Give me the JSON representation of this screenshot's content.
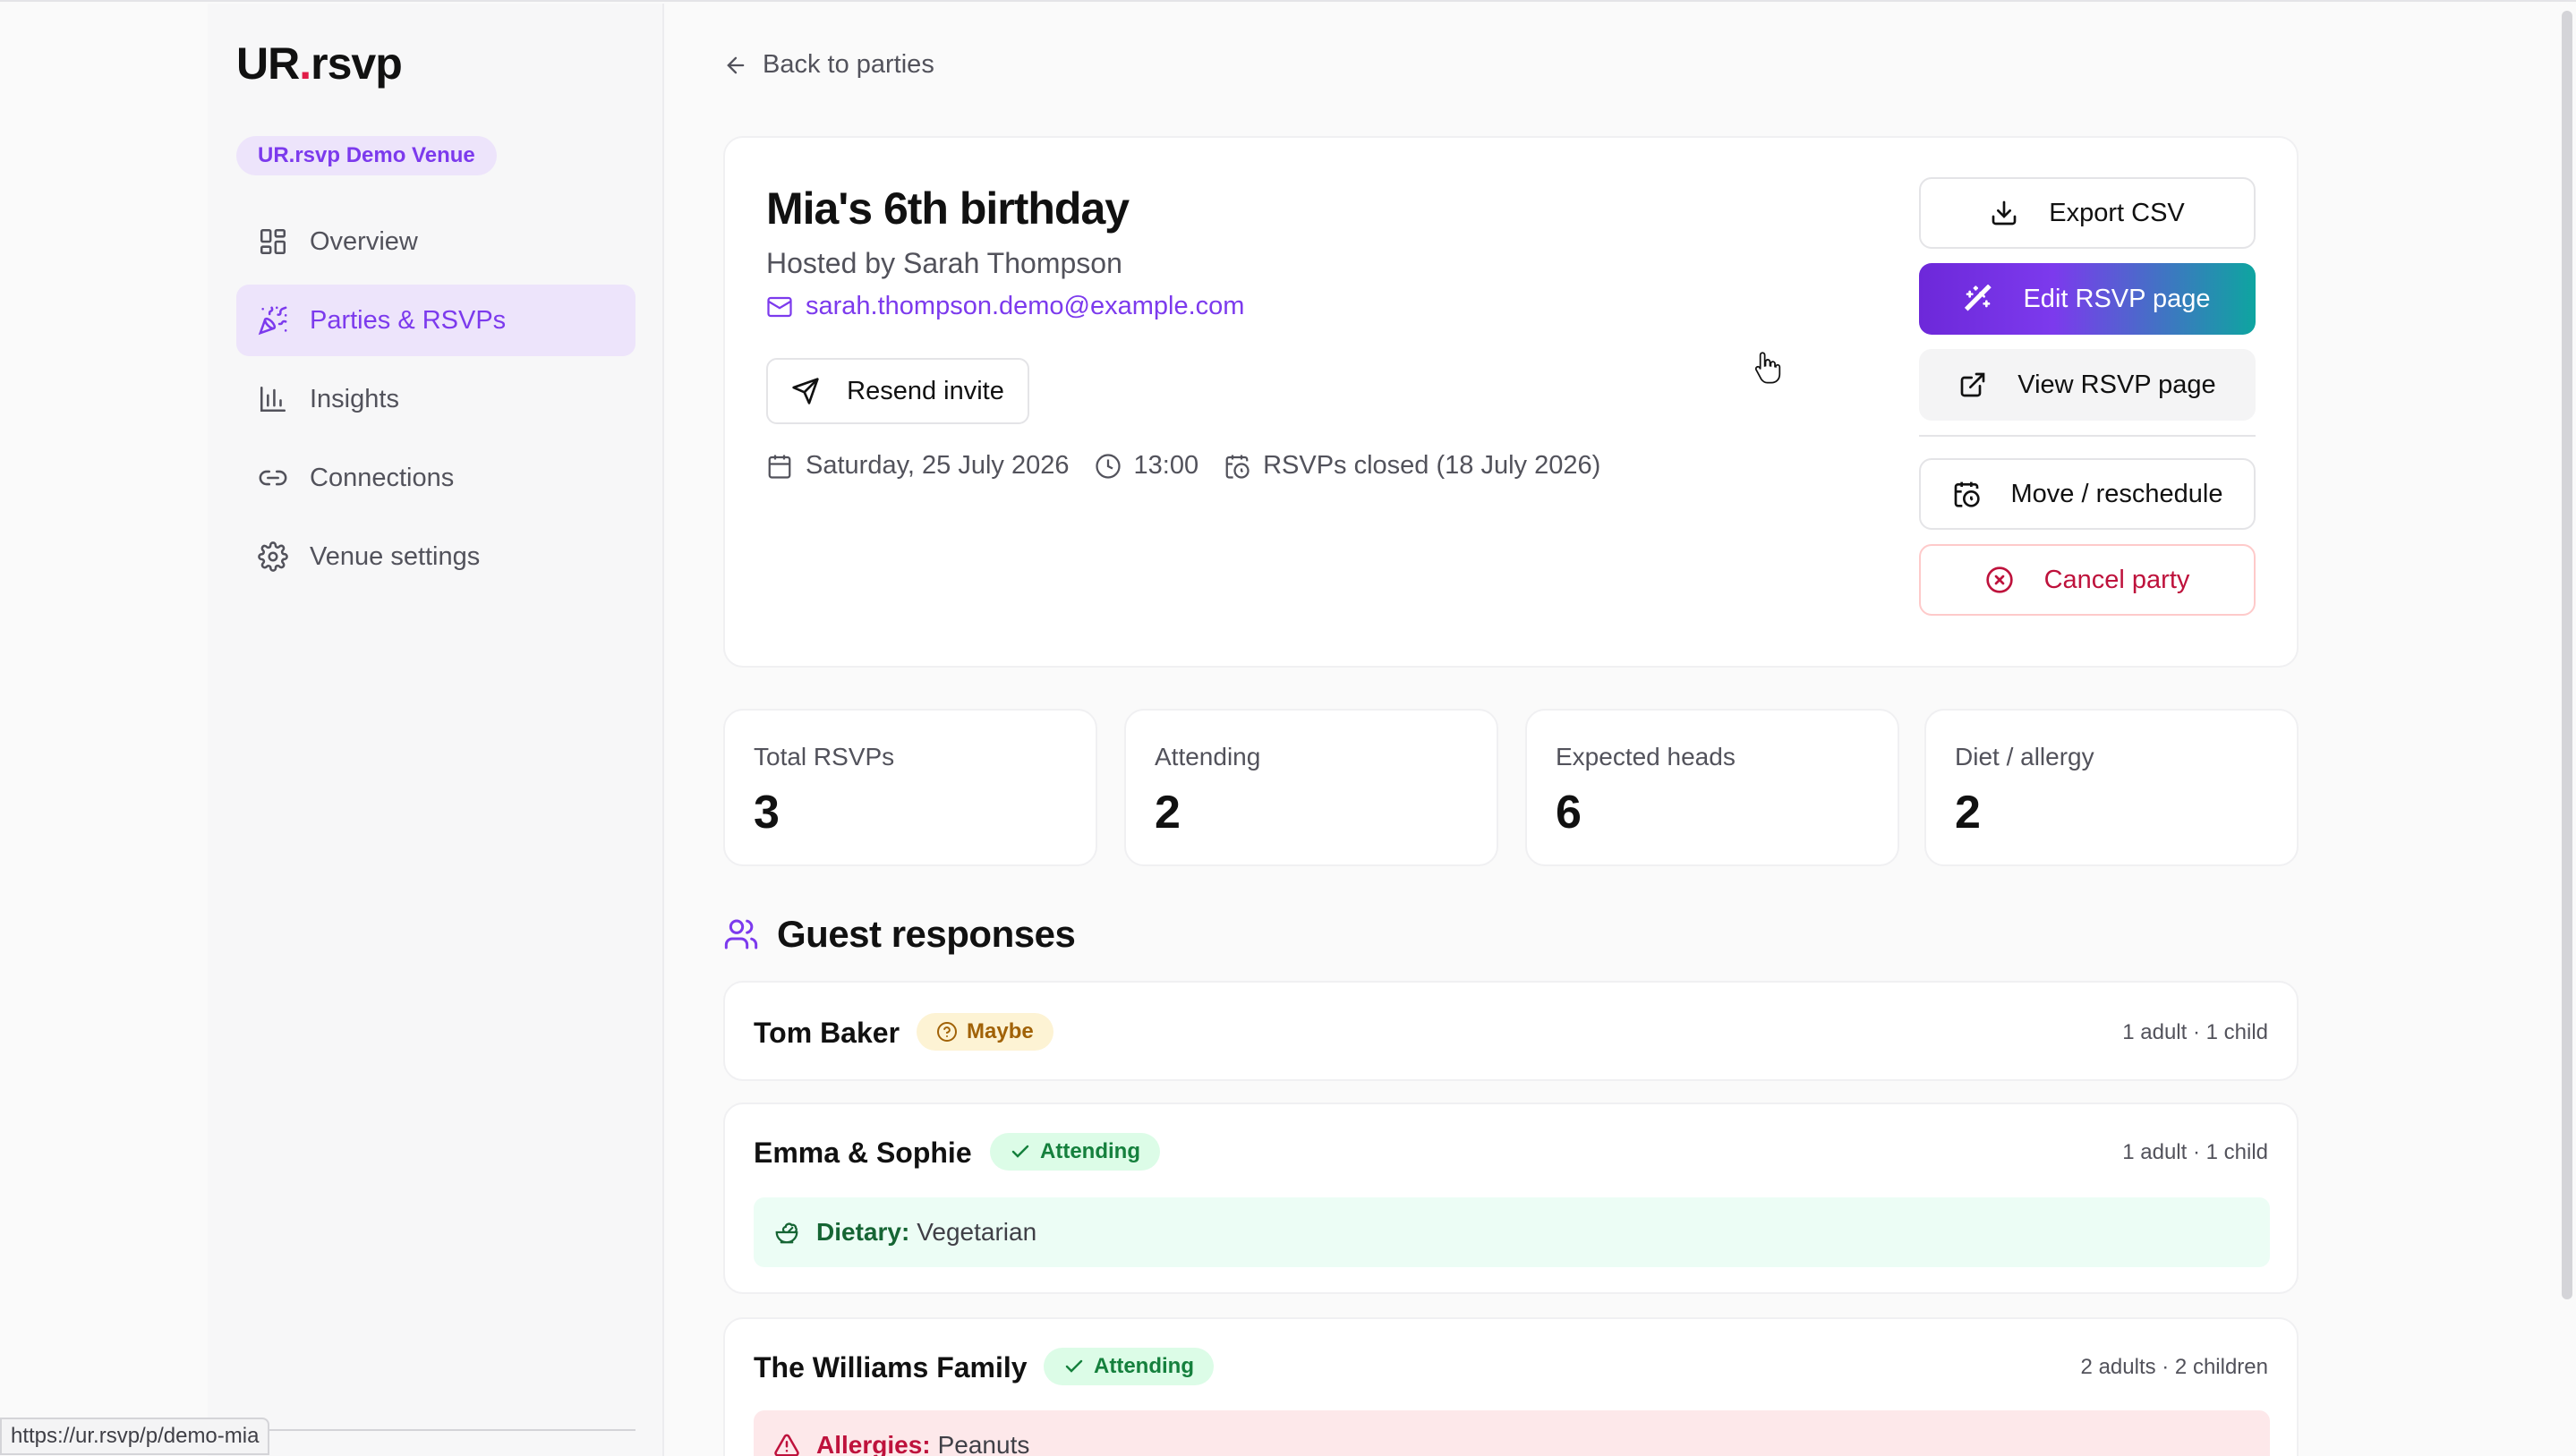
{
  "app": {
    "logo_prefix": "UR",
    "logo_dot": ".",
    "logo_suffix": "rsvp",
    "venue": "UR.rsvp Demo Venue"
  },
  "nav": {
    "items": [
      {
        "label": "Overview",
        "icon": "grid-icon"
      },
      {
        "label": "Parties & RSVPs",
        "icon": "party-popper-icon",
        "active": true
      },
      {
        "label": "Insights",
        "icon": "bar-chart-icon"
      },
      {
        "label": "Connections",
        "icon": "link-icon"
      },
      {
        "label": "Venue settings",
        "icon": "gear-icon"
      }
    ]
  },
  "back": {
    "label": "Back to parties"
  },
  "party": {
    "title": "Mia's 6th birthday",
    "host": "Hosted by Sarah Thompson",
    "email": "sarah.thompson.demo@example.com",
    "resend_label": "Resend invite",
    "date": "Saturday, 25 July 2026",
    "time": "13:00",
    "rsvp_status": "RSVPs closed (18 July 2026)"
  },
  "actions": {
    "export": "Export CSV",
    "edit": "Edit RSVP page",
    "view": "View RSVP page",
    "move": "Move / reschedule",
    "cancel": "Cancel party"
  },
  "stats": [
    {
      "label": "Total RSVPs",
      "value": "3"
    },
    {
      "label": "Attending",
      "value": "2"
    },
    {
      "label": "Expected heads",
      "value": "6"
    },
    {
      "label": "Diet / allergy",
      "value": "2"
    }
  ],
  "guests": {
    "title": "Guest responses",
    "list": [
      {
        "name": "Tom Baker",
        "status": "Maybe",
        "count": "1 adult · 1 child"
      },
      {
        "name": "Emma & Sophie",
        "status": "Attending",
        "count": "1 adult · 1 child",
        "note_label": "Dietary:",
        "note_value": "Vegetarian"
      },
      {
        "name": "The Williams Family",
        "status": "Attending",
        "count": "2 adults · 2 children",
        "note_label": "Allergies:",
        "note_value": "Peanuts"
      }
    ]
  },
  "status_bar": {
    "url": "https://ur.rsvp/p/demo-mia"
  },
  "colors": {
    "accent": "#7c3aed",
    "danger": "#be123c",
    "success": "#15803d",
    "warning": "#a16207"
  }
}
